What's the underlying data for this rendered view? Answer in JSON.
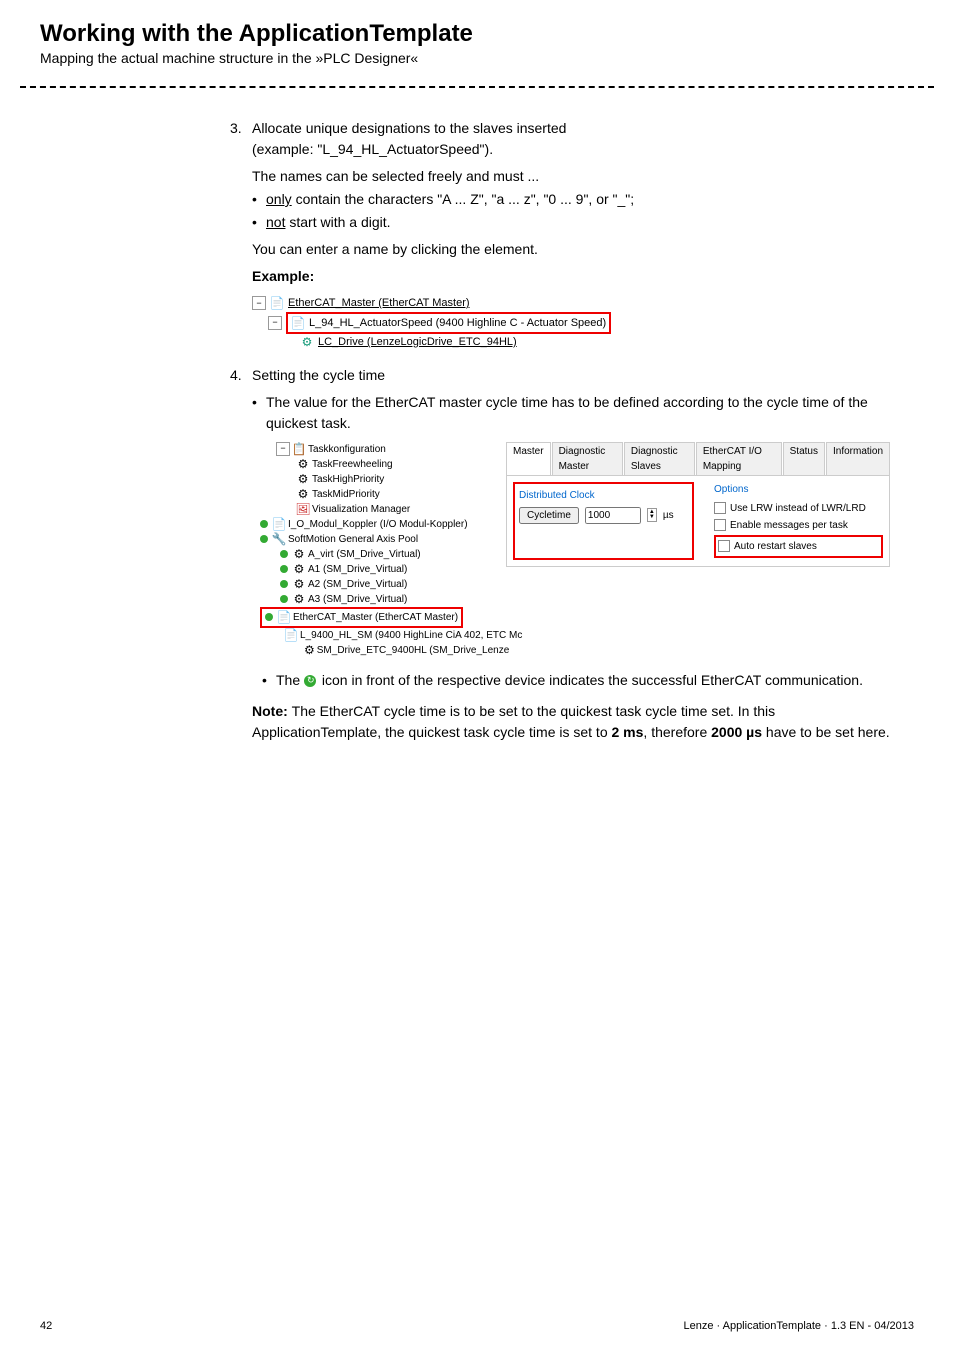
{
  "header": {
    "title": "Working with the ApplicationTemplate",
    "subtitle": "Mapping the actual machine structure in the »PLC Designer«"
  },
  "step3": {
    "num": "3.",
    "text1": "Allocate unique designations to the slaves inserted",
    "text2": "(example: \"L_94_HL_ActuatorSpeed\").",
    "names_intro": "The names can be selected freely and must ...",
    "rule1a": "only",
    "rule1b": " contain the characters \"A ... Z\", \"a ... z\", \"0 ... 9\", or \"_\";",
    "rule2a": "not",
    "rule2b": " start with a digit.",
    "enter_name": "You can enter a name by clicking the element.",
    "example_label": "Example:"
  },
  "tree1": {
    "n1": "EtherCAT_Master (EtherCAT Master)",
    "n2": "L_94_HL_ActuatorSpeed (9400 Highline C - Actuator Speed)",
    "n3": "LC_Drive (LenzeLogicDrive_ETC_94HL)"
  },
  "step4": {
    "num": "4.",
    "title": "Setting the cycle time",
    "bullet1": "The value for the EtherCAT master cycle time has to be defined according to the cycle time of the quickest task."
  },
  "screenshot": {
    "left": {
      "n1": "Taskkonfiguration",
      "n2": "TaskFreewheeling",
      "n3": "TaskHighPriority",
      "n4": "TaskMidPriority",
      "n5": "Visualization Manager",
      "n6": "I_O_Modul_Koppler (I/O Modul-Koppler)",
      "n7": "SoftMotion General Axis Pool",
      "n8": "A_virt (SM_Drive_Virtual)",
      "n9": "A1 (SM_Drive_Virtual)",
      "n10": "A2 (SM_Drive_Virtual)",
      "n11": "A3 (SM_Drive_Virtual)",
      "n12": "EtherCAT_Master (EtherCAT Master)",
      "n13": "L_9400_HL_SM (9400 HighLine CiA 402, ETC Mc",
      "n14": "SM_Drive_ETC_9400HL (SM_Drive_Lenze"
    },
    "right": {
      "tabs": [
        "Master",
        "Diagnostic Master",
        "Diagnostic Slaves",
        "EtherCAT I/O Mapping",
        "Status",
        "Information"
      ],
      "clock_hd": "Distributed Clock",
      "cycle_btn": "Cycletime",
      "cycle_val": "1000",
      "unit": "µs",
      "opt_hd": "Options",
      "opt1": "Use LRW instead of LWR/LRD",
      "opt2": "Enable messages per task",
      "opt3": "Auto restart slaves"
    }
  },
  "icon_note": {
    "pre": "The ",
    "post": " icon in front of the respective device indicates the successful EtherCAT communication."
  },
  "note": {
    "label": "Note: ",
    "t1": "The EtherCAT cycle time is to be set to the quickest task cycle time set. In this ApplicationTemplate, the quickest task cycle time is set to ",
    "b1": "2 ms",
    "t2": ", therefore ",
    "b2": "2000 µs",
    "t3": " have to be set here."
  },
  "footer": {
    "page": "42",
    "right": "Lenze · ApplicationTemplate · 1.3 EN - 04/2013"
  }
}
